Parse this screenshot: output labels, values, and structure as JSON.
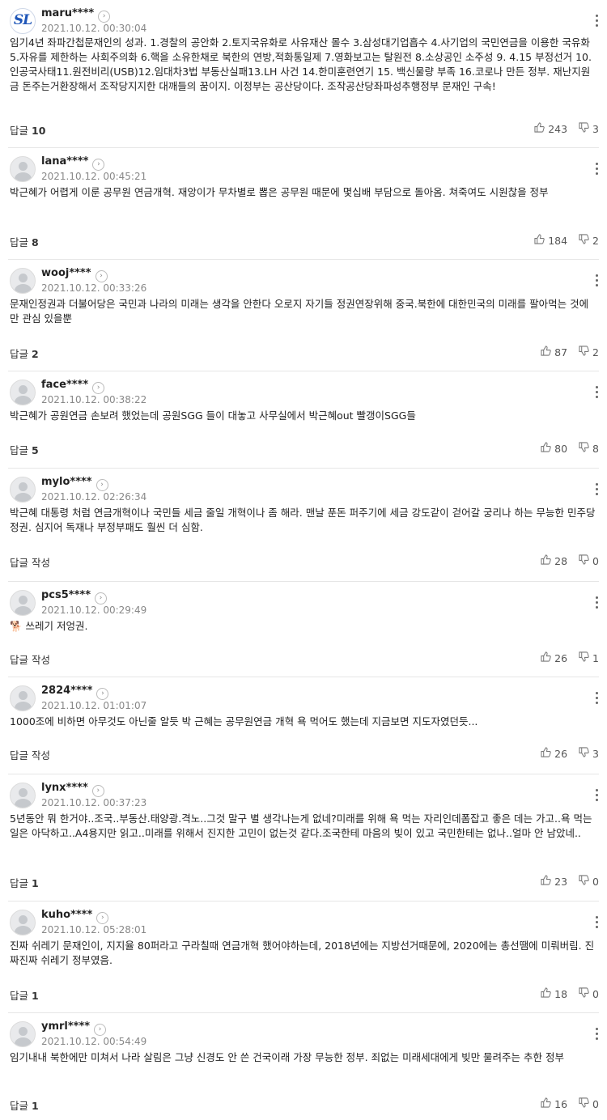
{
  "labels": {
    "reply": "답글",
    "write_reply": "작성"
  },
  "comments": [
    {
      "user": "maru****",
      "date": "2021.10.12. 00:30:04",
      "avatar": "SL",
      "text": "임기4년 좌파간첩문재인의 성과. 1.경찰의 공안화 2.토지국유화로 사유재산 몰수 3.삼성대기업흡수 4.사기업의 국민연금을 이용한 국유화 5.자유를 제한하는 사회주의화 6.핵을 소유한채로 북한의 연방,적화통일제 7.영화보고는 탈원전 8.소상공인 소주성 9. 4.15 부정선거 10.인공국사태11.원전비리(USB)12.임대차3법 부동산실패13.LH 사건 14.한미훈련연기 15. 백신물량 부족 16.코로나 만든 정부. 재난지원금 돈주는거환장해서 조작당지지한 대깨들의 꿈이지. 이정부는 공산당이다. 조작공산당좌파성추행정부 문재인 구속!",
      "reply_count": "10",
      "likes": "243",
      "dislikes": "3"
    },
    {
      "user": "lana****",
      "date": "2021.10.12. 00:45:21",
      "avatar": "",
      "text": "박근혜가 어렵게 이룬 공무원 연금개혁. 재앙이가 무차별로 뽑은 공무원 때문에 몇십배 부담으로 돌아옴. 쳐죽여도 시원찮을 정부",
      "reply_count": "8",
      "likes": "184",
      "dislikes": "2"
    },
    {
      "user": "wooj****",
      "date": "2021.10.12. 00:33:26",
      "avatar": "",
      "text": "문재인정권과 더불어당은 국민과 나라의 미래는 생각을 안한다 오로지 자기들 정권연장위해 중국.북한에 대한민국의 미래를 팔아먹는 것에만 관심 있을뿐",
      "reply_count": "2",
      "likes": "87",
      "dislikes": "2"
    },
    {
      "user": "face****",
      "date": "2021.10.12. 00:38:22",
      "avatar": "",
      "text": "박근혜가 공원연금 손보려 했었는데 공원SGG 들이 대놓고 사무실에서 박근혜out 빨갱이SGG들",
      "reply_count": "5",
      "likes": "80",
      "dislikes": "8"
    },
    {
      "user": "mylo****",
      "date": "2021.10.12. 02:26:34",
      "avatar": "",
      "text": "박근혜 대통령 처럼 연금개혁이나 국민들 세금 줄일 개혁이나 좀 해라. 맨날 푼돈 퍼주기에 세금 강도같이 걷어갈 궁리나 하는 무능한 민주당 정권. 심지어 독재나 부정부패도 훨씬 더 심함.",
      "reply_count": "",
      "likes": "28",
      "dislikes": "0"
    },
    {
      "user": "pcs5****",
      "date": "2021.10.12. 00:29:49",
      "avatar": "",
      "text": "🐕 쓰레기 저엉권.",
      "reply_count": "",
      "likes": "26",
      "dislikes": "1"
    },
    {
      "user": "2824****",
      "date": "2021.10.12. 01:01:07",
      "avatar": "",
      "text": "1000조에 비하면 아무것도 아닌줄 알듯 박 근혜는 공무원연금 개혁 욕 먹어도 했는데 지금보면 지도자였던듯...",
      "reply_count": "",
      "likes": "26",
      "dislikes": "3"
    },
    {
      "user": "lynx****",
      "date": "2021.10.12. 00:37:23",
      "avatar": "",
      "text": "5년동안 뭐 한거야..조국..부동산.태양광.격노..그것 말구 별 생각나는게 없네?미래를 위해 욕 먹는 자리인데폼잡고 좋은 데는 가고..욕 먹는 일은 아닥하고..A4용지만 읽고..미래를 위해서 진지한 고민이 없는것 같다.조국한테 마음의 빚이 있고 국민한테는 없나..얼마 안 남았네..",
      "reply_count": "1",
      "likes": "23",
      "dislikes": "0"
    },
    {
      "user": "kuho****",
      "date": "2021.10.12. 05:28:01",
      "avatar": "",
      "text": "진짜 쉬레기 문재인이, 지지율 80퍼라고 구라칠때 연금개혁 했어야하는데, 2018년에는 지방선거때문에, 2020에는 총선땜에 미뤄버림. 진짜진짜 쉬레기 정부였음.",
      "reply_count": "1",
      "likes": "18",
      "dislikes": "0"
    },
    {
      "user": "ymrl****",
      "date": "2021.10.12. 00:54:49",
      "avatar": "",
      "text": "임기내내 북한에만 미쳐서 나라 살림은 그냥 신경도 안 쓴 건국이래 가장 무능한 정부. 죄없는 미래세대에게 빚만 물려주는 추한 정부",
      "reply_count": "1",
      "likes": "16",
      "dislikes": "0"
    }
  ]
}
